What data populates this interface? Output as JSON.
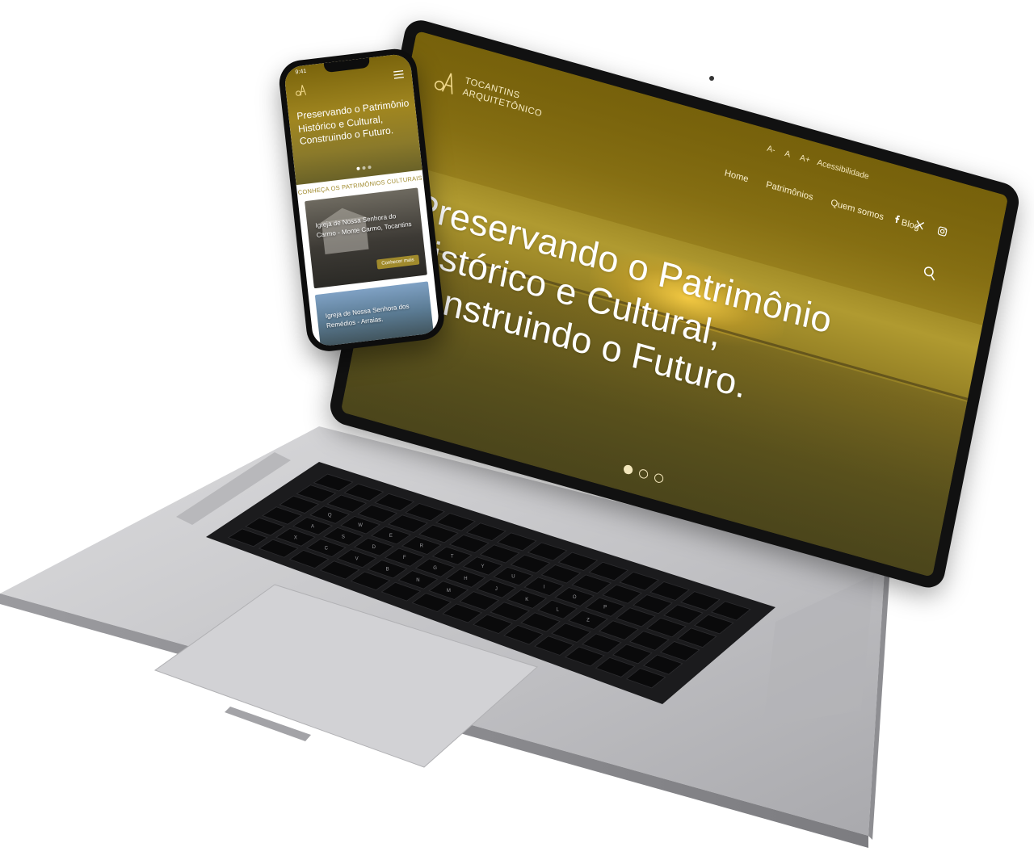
{
  "laptop": {
    "site": {
      "logo_line1": "TOCANTINS",
      "logo_line2": "ARQUITETÔNICO",
      "font_controls": [
        "A-",
        "A",
        "A+"
      ],
      "accessibility": "Acessibilidade",
      "nav": [
        "Home",
        "Patrimônios",
        "Quem somos",
        "Blog"
      ],
      "social_icons": [
        "facebook-icon",
        "x-icon",
        "instagram-icon"
      ],
      "hero_title": "Preservando o Patrimônio Histórico e Cultural, Construindo o Futuro.",
      "slide_count": 3,
      "active_slide": 1
    },
    "keyboard": {
      "labels": [
        "esc",
        "tab",
        "caps lock",
        "shift",
        "control",
        "option",
        "command",
        "delete",
        "return",
        "shift",
        "command",
        "option"
      ],
      "letters": [
        "Q",
        "W",
        "E",
        "R",
        "T",
        "Y",
        "U",
        "I",
        "O",
        "P",
        "A",
        "S",
        "D",
        "F",
        "G",
        "H",
        "J",
        "K",
        "L",
        "Z",
        "X",
        "C",
        "V",
        "B",
        "N",
        "M"
      ]
    }
  },
  "phone": {
    "time": "9:41",
    "hero_title": "Preservando o Patrimônio Histórico e Cultural, Construindo o Futuro.",
    "section_title": "CONHEÇA OS PATRIMÔNIOS CULTURAIS",
    "cards": [
      {
        "title": "Igreja de Nossa Senhora do Carmo - Monte Carmo, Tocantins",
        "button": "Conhecer mais"
      },
      {
        "title": "Igreja de Nossa Senhora dos Remédios - Arraias."
      }
    ]
  },
  "colors": {
    "gold_dark": "#7a640c",
    "gold_mid": "#b09a30",
    "accent": "#a08a2c",
    "aluminium": "#c9c9cb"
  }
}
